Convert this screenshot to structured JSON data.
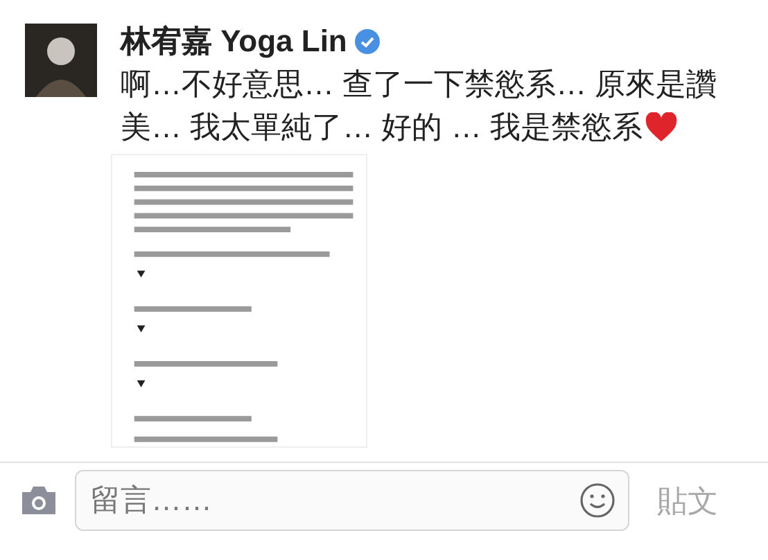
{
  "post": {
    "author": "林宥嘉 Yoga Lin",
    "verified": true,
    "text_lines": [
      "啊…不好意思… 查了一下禁慾系… 原來是讚",
      "美… 我太單純了… 好的 … 我是禁慾系"
    ]
  },
  "comment_bar": {
    "placeholder": "留言……",
    "post_button": {
      "label": "貼文",
      "disabled": true
    }
  }
}
